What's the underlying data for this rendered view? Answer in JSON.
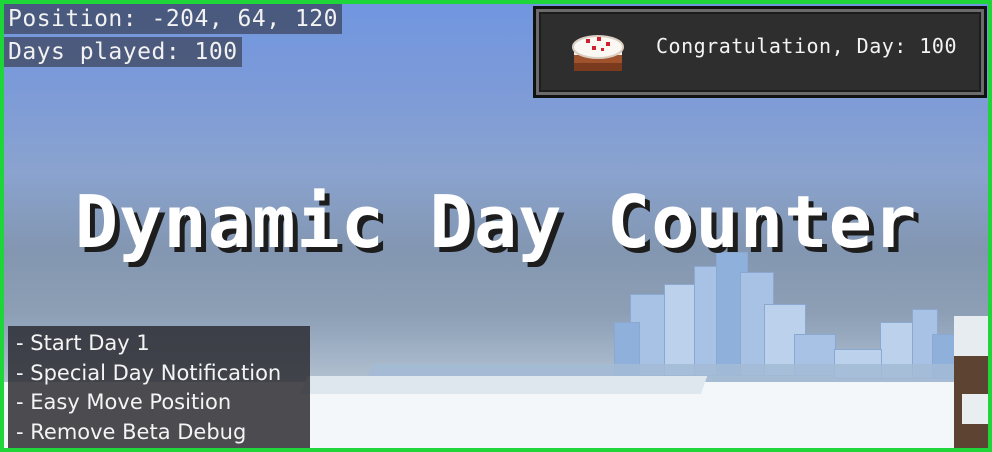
{
  "hud": {
    "position_label": "Position: -204, 64, 120",
    "days_label": "Days played: 100"
  },
  "toast": {
    "icon": "cake-icon",
    "message": "Congratulation, Day: 100"
  },
  "title": "Dynamic Day Counter",
  "features": [
    "- Start Day 1",
    "- Special Day Notification",
    "- Easy Move Position",
    "- Remove Beta Debug"
  ],
  "colors": {
    "border": "#1ed53a",
    "sky": "#7196e0",
    "toast_bg": "#2e2e2e"
  }
}
